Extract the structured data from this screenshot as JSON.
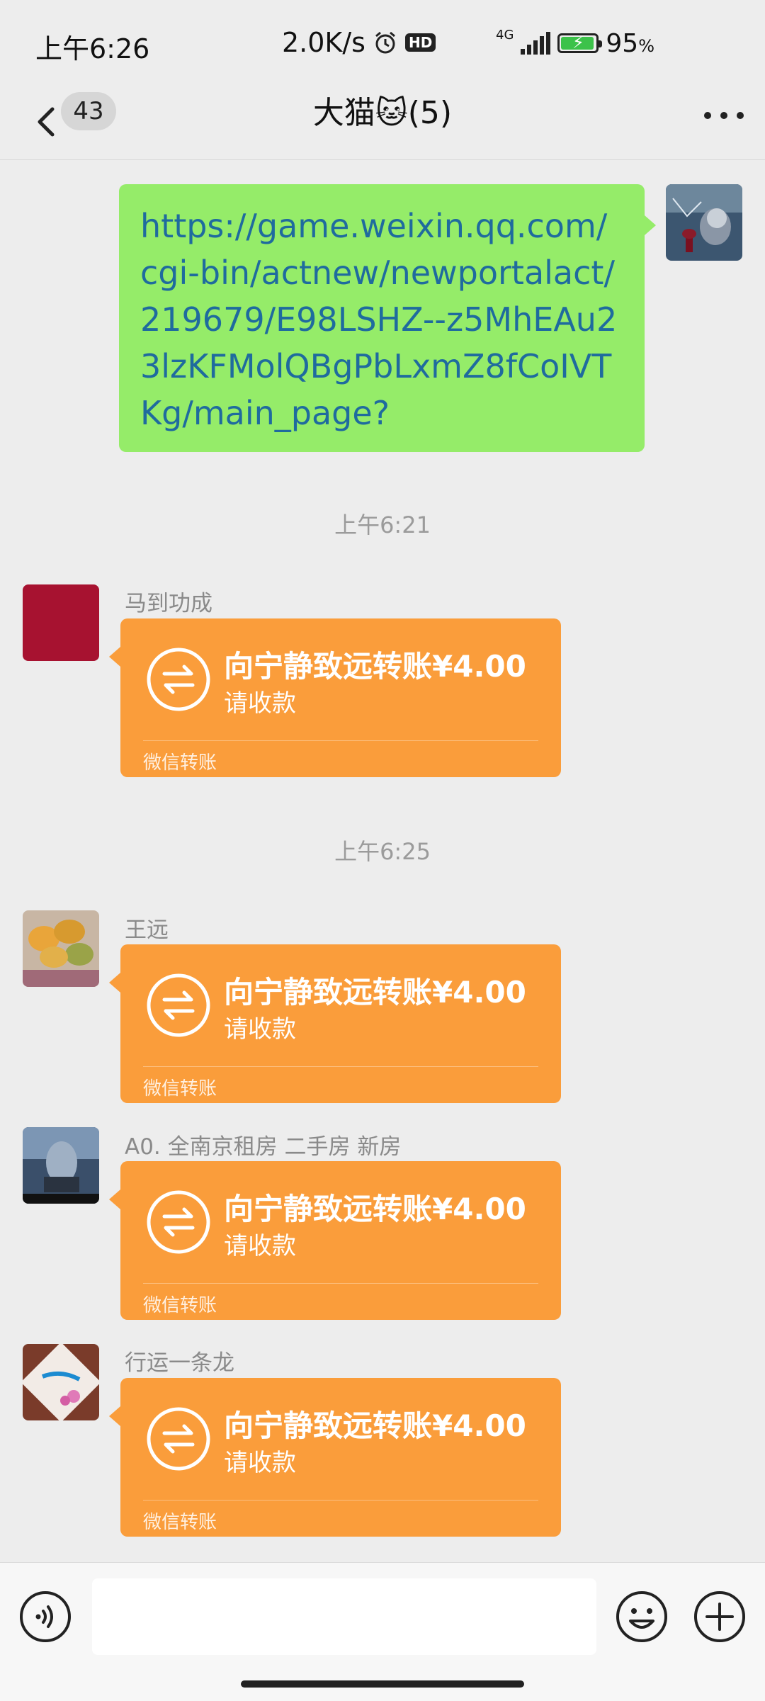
{
  "status_bar": {
    "time": "上午6:26",
    "net_speed": "2.0K/s",
    "hd_label": "HD",
    "network_type": "4G",
    "battery_percent": "95",
    "battery_unit": "%"
  },
  "nav": {
    "unread_count": "43",
    "title": "大猫🐱(5)"
  },
  "messages": {
    "link": {
      "text": "https://game.weixin.qq.com/cgi-bin/actnew/newportalact/219679/E98LSHZ--z5MhEAu23lzKFMolQBgPbLxmZ8fCoIVTKg/main_page?"
    },
    "time_1": "上午6:21",
    "time_2": "上午6:25",
    "transfers": [
      {
        "sender": "马到功成",
        "title": "向宁静致远转账¥4.00",
        "subtitle": "请收款",
        "footer": "微信转账"
      },
      {
        "sender": "王远",
        "title": "向宁静致远转账¥4.00",
        "subtitle": "请收款",
        "footer": "微信转账"
      },
      {
        "sender": "A0. 全南京租房 二手房 新房",
        "title": "向宁静致远转账¥4.00",
        "subtitle": "请收款",
        "footer": "微信转账"
      },
      {
        "sender": "行运一条龙",
        "title": "向宁静致远转账¥4.00",
        "subtitle": "请收款",
        "footer": "微信转账"
      }
    ]
  },
  "input_bar": {
    "placeholder": ""
  },
  "colors": {
    "background": "#ededed",
    "self_bubble": "#95ec69",
    "transfer_card": "#fa9d3b",
    "link_text": "#1f6b9e"
  }
}
